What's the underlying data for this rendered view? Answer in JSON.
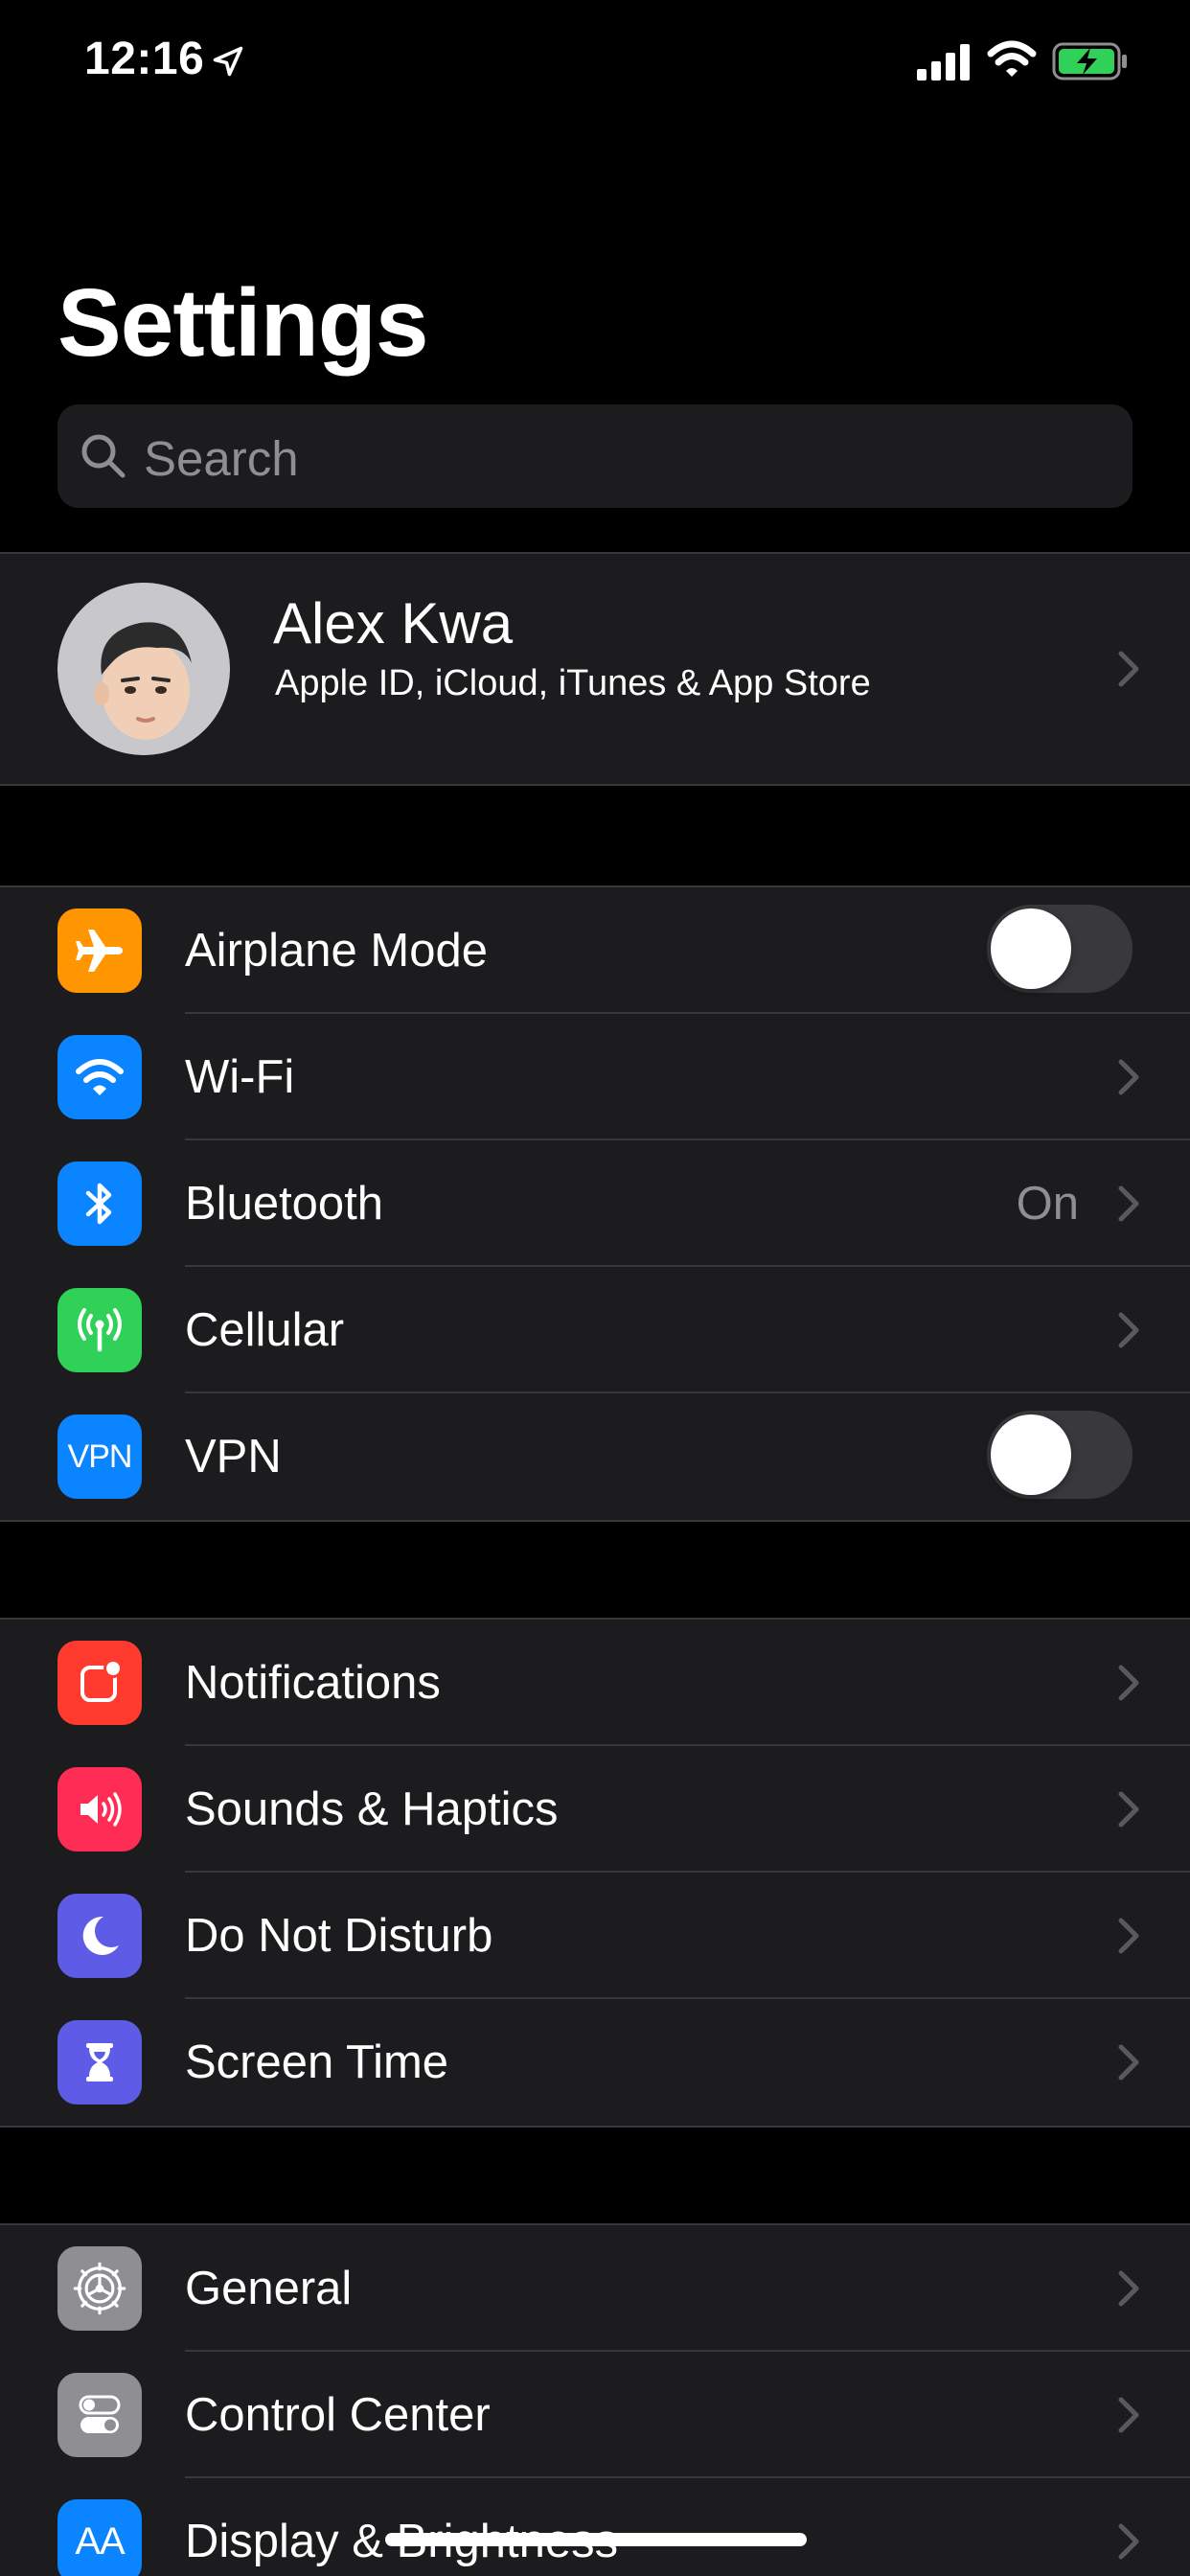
{
  "status_bar": {
    "time": "12:16"
  },
  "title": "Settings",
  "search": {
    "placeholder": "Search"
  },
  "profile": {
    "name": "Alex Kwa",
    "subtitle": "Apple ID, iCloud, iTunes & App Store"
  },
  "groups": [
    {
      "rows": [
        {
          "label": "Airplane Mode",
          "icon": "airplane-icon",
          "color": "#ff9500",
          "accessory": "toggle",
          "toggle_on": false
        },
        {
          "label": "Wi-Fi",
          "icon": "wifi-icon",
          "color": "#0a84ff",
          "accessory": "chevron"
        },
        {
          "label": "Bluetooth",
          "icon": "bluetooth-icon",
          "color": "#0a84ff",
          "accessory": "chevron",
          "value": "On"
        },
        {
          "label": "Cellular",
          "icon": "cellular-icon",
          "color": "#30d158",
          "accessory": "chevron"
        },
        {
          "label": "VPN",
          "icon": "vpn-icon",
          "icon_text": "VPN",
          "color": "#0a84ff",
          "accessory": "toggle",
          "toggle_on": false
        }
      ]
    },
    {
      "rows": [
        {
          "label": "Notifications",
          "icon": "notifications-icon",
          "color": "#ff3b30",
          "accessory": "chevron"
        },
        {
          "label": "Sounds & Haptics",
          "icon": "speaker-icon",
          "color": "#ff2d55",
          "accessory": "chevron"
        },
        {
          "label": "Do Not Disturb",
          "icon": "moon-icon",
          "color": "#5e5ce6",
          "accessory": "chevron"
        },
        {
          "label": "Screen Time",
          "icon": "hourglass-icon",
          "color": "#5e5ce6",
          "accessory": "chevron"
        }
      ]
    },
    {
      "rows": [
        {
          "label": "General",
          "icon": "gear-icon",
          "color": "#8e8e93",
          "accessory": "chevron"
        },
        {
          "label": "Control Center",
          "icon": "control-center-icon",
          "color": "#8e8e93",
          "accessory": "chevron"
        },
        {
          "label": "Display & Brightness",
          "icon": "display-icon",
          "icon_text": "AA",
          "color": "#0a84ff",
          "accessory": "chevron"
        }
      ]
    }
  ]
}
